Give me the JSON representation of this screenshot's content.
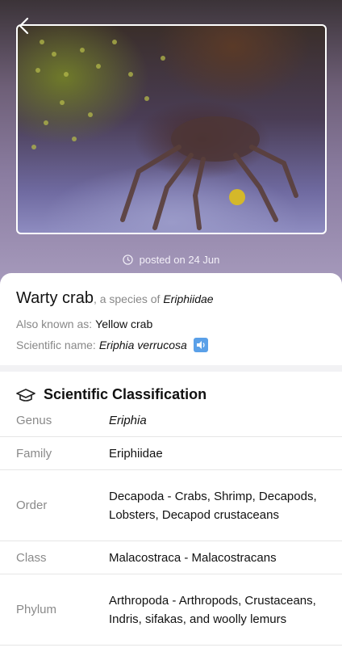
{
  "header": {
    "back_icon": "chevron-left-icon"
  },
  "photo": {
    "alt_name": "crab-photo"
  },
  "post": {
    "posted_text": "posted on 24 Jun",
    "icon": "clock-icon"
  },
  "species": {
    "common_name": "Warty crab",
    "species_of_prefix": ", a species of ",
    "family": "Eriphiidae",
    "aka_label": "Also known as:",
    "aka_value": "Yellow crab",
    "sci_label": "Scientific name:",
    "sci_value": "Eriphia verrucosa",
    "audio_icon": "speaker-icon"
  },
  "classification": {
    "heading": "Scientific Classification",
    "icon": "graduation-cap-icon",
    "rows": [
      {
        "label": "Genus",
        "value": "Eriphia",
        "italic": true
      },
      {
        "label": "Family",
        "value": "Eriphiidae"
      },
      {
        "label": "Order",
        "value": "Decapoda - Crabs, Shrimp, Decapods, Lobsters, Decapod crustaceans"
      },
      {
        "label": "Class",
        "value": "Malacostraca - Malacostracans"
      },
      {
        "label": "Phylum",
        "value": "Arthropoda - Arthropods, Crustaceans, Indris, sifakas, and woolly lemurs"
      }
    ]
  }
}
